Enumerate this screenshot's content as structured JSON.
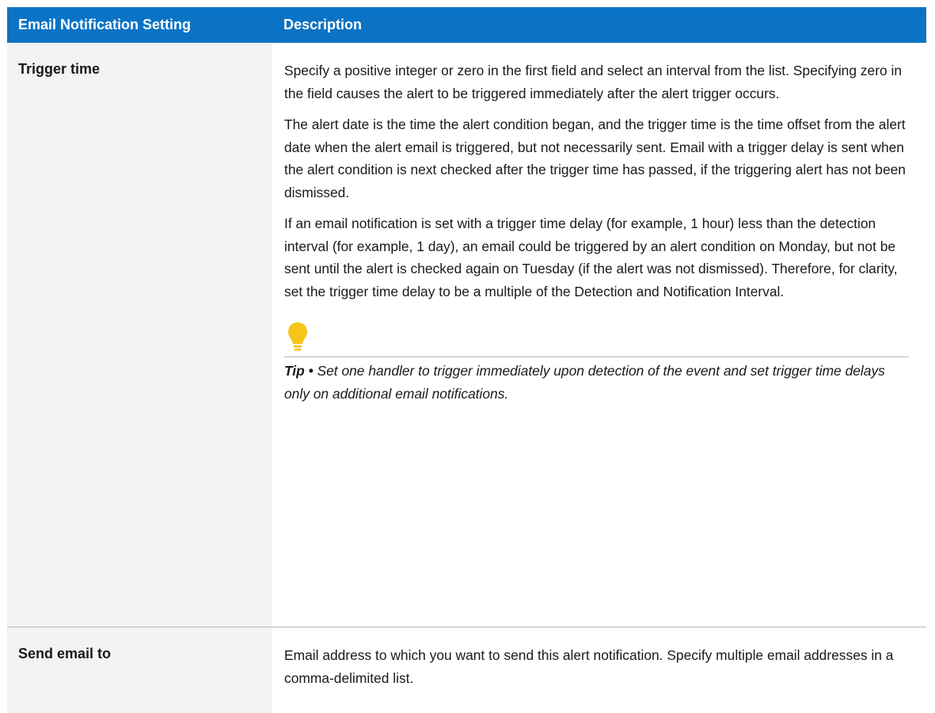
{
  "table": {
    "header": {
      "setting": "Email Notification Setting",
      "description": "Description"
    },
    "rows": [
      {
        "setting": "Trigger time",
        "paragraphs": [
          "Specify a positive integer or zero in the first field and select an interval from the list. Specifying zero in the field causes the alert to be triggered immediately after the alert trigger occurs.",
          "The alert date is the time the alert condition began, and the trigger time is the time offset from the alert date when the alert email is triggered, but not necessarily sent. Email with a trigger delay is sent when the alert condition is next checked after the trigger time has passed, if the triggering alert has not been dismissed.",
          "If an email notification is set with a trigger time delay (for example, 1 hour) less than the detection interval (for example, 1 day), an email could be triggered by an alert condition on Monday, but not be sent until the alert is checked again on Tuesday (if the alert was not dismissed). Therefore, for clarity, set the trigger time delay to be a multiple of the Detection and Notification Interval."
        ],
        "tip": {
          "icon": "lightbulb-icon",
          "label": "Tip •",
          "text": "Set one handler to trigger immediately upon detection of the event and set trigger time delays only on additional email notifications."
        }
      },
      {
        "setting": "Send email to",
        "paragraphs": [
          "Email address to which you want to send this alert notification. Specify multiple email addresses in a comma-delimited list."
        ]
      }
    ]
  },
  "colors": {
    "header_bg": "#0a73c5",
    "setting_col_bg": "#f3f3f3",
    "tip_icon": "#f5c518"
  }
}
